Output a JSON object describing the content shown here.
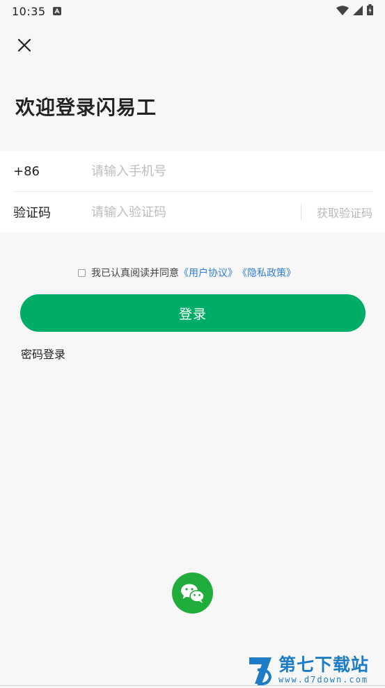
{
  "status_bar": {
    "time": "10:35",
    "notification_icon": "a-badge-icon",
    "wifi_icon": "wifi-icon",
    "signal_icon": "signal-icon",
    "battery_icon": "battery-charging-icon"
  },
  "header": {
    "close_icon": "close-icon",
    "title": "欢迎登录闪易工"
  },
  "form": {
    "phone_prefix": "+86",
    "phone_placeholder": "请输入手机号",
    "code_label": "验证码",
    "code_placeholder": "请输入验证码",
    "get_code_label": "获取验证码"
  },
  "agreement": {
    "text": "我已认真阅读并同意",
    "user_agreement": "《用户协议》",
    "privacy_policy": "《隐私政策》"
  },
  "login_button": "登录",
  "password_login": "密码登录",
  "wechat_login_icon": "wechat-icon",
  "watermark": {
    "name": "第七下载站",
    "url": "www.d7down.com"
  },
  "colors": {
    "primary": "#00ad67",
    "link": "#2f7fd6",
    "wechat": "#21ad3c",
    "background": "#f7f7f7"
  }
}
